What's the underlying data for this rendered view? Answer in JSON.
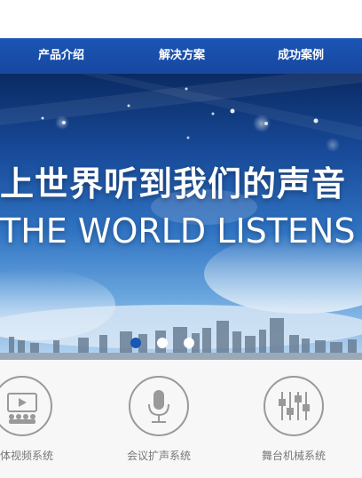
{
  "nav": {
    "items": [
      {
        "label": "产品介绍"
      },
      {
        "label": "解决方案"
      },
      {
        "label": "成功案例"
      }
    ]
  },
  "banner": {
    "headline_cn": "上世界听到我们的声音",
    "headline_en": "THE WORLD LISTENS",
    "slide_count": 3,
    "active_slide": 1
  },
  "services": [
    {
      "label": "媒体视频系统",
      "icon": "video-system-icon"
    },
    {
      "label": "会议扩声系统",
      "icon": "microphone-icon"
    },
    {
      "label": "舞台机械系统",
      "icon": "mixer-sliders-icon"
    }
  ],
  "colors": {
    "nav_bg": "#1a56b4",
    "dot_active": "#1a56b4",
    "dot_inactive": "#ffffff",
    "icon_gray": "#999999"
  }
}
